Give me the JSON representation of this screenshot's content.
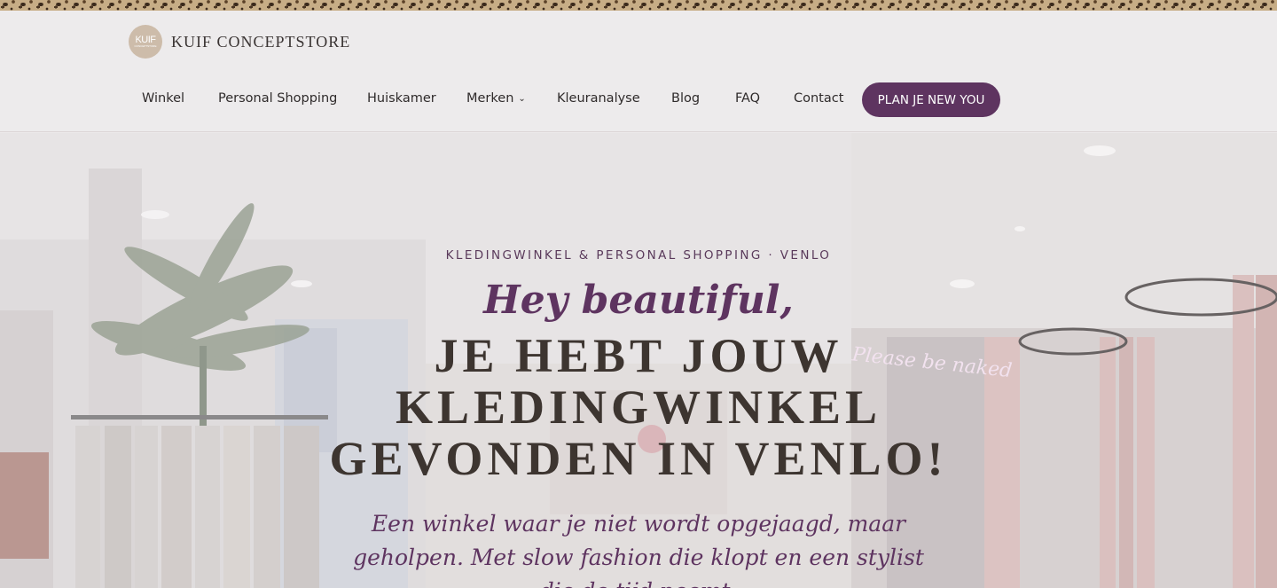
{
  "brand": {
    "logo_mark_top": "KUIF",
    "logo_mark_bottom": "CONCEPTSTORE",
    "name": "KUIF CONCEPTSTORE"
  },
  "nav": {
    "items": [
      {
        "label": "Winkel"
      },
      {
        "label": "Personal Shopping"
      },
      {
        "label": "Huiskamer"
      },
      {
        "label": "Merken",
        "has_dropdown": true
      },
      {
        "label": "Kleuranalyse"
      },
      {
        "label": "Blog"
      },
      {
        "label": "FAQ"
      },
      {
        "label": "Contact"
      }
    ],
    "cta_label": "PLAN JE NEW YOU",
    "dropdown_icon": "chevron-down-icon"
  },
  "hero": {
    "eyebrow": "KLEDINGWINKEL & PERSONAL SHOPPING · VENLO",
    "greeting": "Hey beautiful,",
    "headline_lines": [
      "JE HEBT JOUW",
      "KLEDINGWINKEL",
      "GEVONDEN IN VENLO!"
    ],
    "subtext": "Een winkel waar je niet wordt opgejaagd, maar geholpen. Met slow fashion die klopt en een stylist die de tijd neemt.",
    "neon_sign": "Please be naked"
  },
  "colors": {
    "accent": "#5e3460",
    "text_dark": "#3d3530",
    "header_bg": "#edebec"
  }
}
